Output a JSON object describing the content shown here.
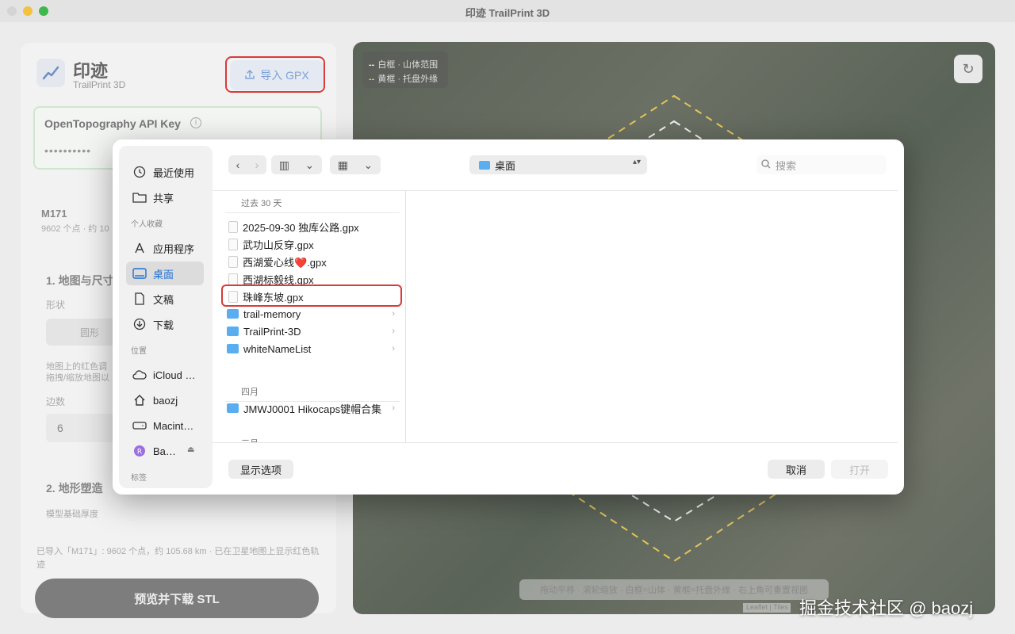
{
  "window": {
    "title": "印迹 TrailPrint 3D"
  },
  "app": {
    "brand_cn": "印迹",
    "brand_en": "TrailPrint 3D",
    "import_label": "导入 GPX",
    "api_title": "OpenTopography API Key",
    "api_info": "i",
    "api_value": "••••••••••",
    "track_name": "M171",
    "track_info": "9602 个点 · 约 10",
    "section1": "1. 地图与尺寸",
    "shape_label": "形状",
    "shape_chip": "圆形",
    "hint1": "地图上的红色调",
    "hint2": "拖拽/缩放地图以",
    "sides_label": "边数",
    "sides_value": "6",
    "section2": "2. 地形塑造",
    "thickness_label": "模型基础厚度",
    "status": "已导入「M171」: 9602 个点，约 105.68 km · 已在卫星地图上显示红色轨迹",
    "stl_button": "预览并下载 STL"
  },
  "map": {
    "legend_white": "白框 · 山体范围",
    "legend_yellow": "黄框 · 托盘外缘",
    "legend_dash": "--",
    "reset_icon": "↻",
    "hint": "拖动平移 · 滚轮缩放 · 白框=山体 · 黄框=托盘外缘 · 右上角可重置视图",
    "attribution": "Leaflet | Tiles",
    "colors": {
      "white_frame": "#f0f0f0",
      "yellow_frame": "#e3c55a"
    }
  },
  "dialog": {
    "sidebar": {
      "recent": "最近使用",
      "shared": "共享",
      "favorites_header": "个人收藏",
      "apps": "应用程序",
      "desktop": "桌面",
      "documents": "文稿",
      "downloads": "下载",
      "locations_header": "位置",
      "icloud": "iCloud …",
      "home": "baozj",
      "macint": "Macint…",
      "ba": "Ba…",
      "tags_header": "标签"
    },
    "nav_back": "‹",
    "nav_forward": "›",
    "view_icon": "▥",
    "grid_icon": "▦",
    "chevron": "⌄",
    "path": "桌面",
    "search_placeholder": "搜索",
    "group_recent": "过去 30 天",
    "files": [
      {
        "name": "2025-09-30 独库公路.gpx",
        "kind": "file"
      },
      {
        "name": "武功山反穿.gpx",
        "kind": "file"
      },
      {
        "name": "西湖爱心线❤️.gpx",
        "kind": "file"
      },
      {
        "name": "西湖标毅线.gpx",
        "kind": "file"
      },
      {
        "name": "珠峰东坡.gpx",
        "kind": "file"
      },
      {
        "name": "trail-memory",
        "kind": "folder"
      },
      {
        "name": "TrailPrint-3D",
        "kind": "folder"
      },
      {
        "name": "whiteNameList",
        "kind": "folder"
      }
    ],
    "group_april": "四月",
    "april_files": [
      {
        "name": "JMWJ0001 Hikocaps键帽合集",
        "kind": "folder"
      }
    ],
    "group_more": "三月",
    "options_button": "显示选项",
    "cancel_button": "取消",
    "open_button": "打开"
  },
  "watermark": "掘金技术社区 @ baozj"
}
